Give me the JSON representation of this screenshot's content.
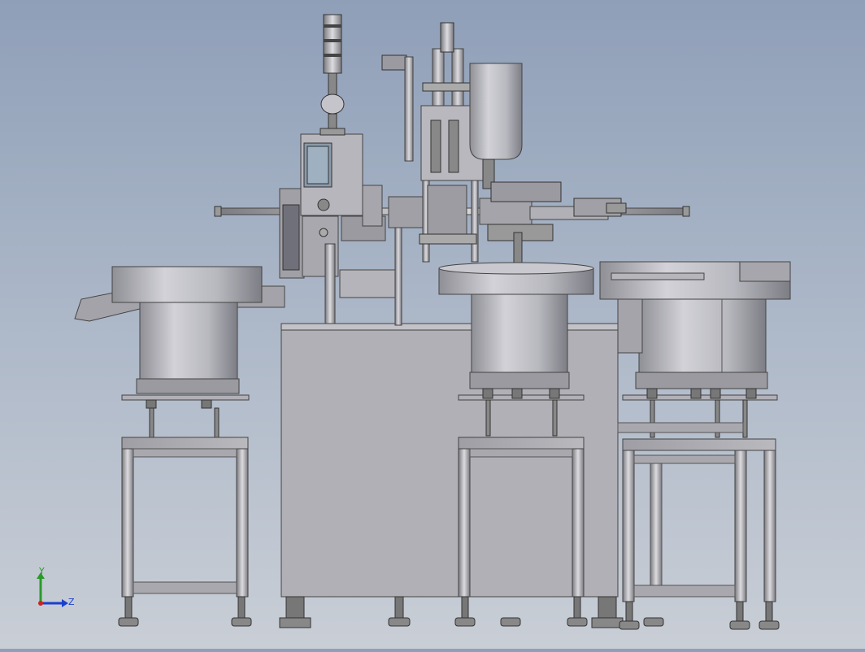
{
  "viewport": {
    "background_top": "#8f9fb8",
    "background_bottom": "#c9ced6",
    "model_color": "#a9a9ad",
    "model_dark": "#6f6f74",
    "model_light": "#d6d6da"
  },
  "triad": {
    "y_label": "Y",
    "z_label": "Z",
    "y_color": "#2a9a2a",
    "z_color": "#1a3fd0",
    "x_color": "#d02020"
  }
}
